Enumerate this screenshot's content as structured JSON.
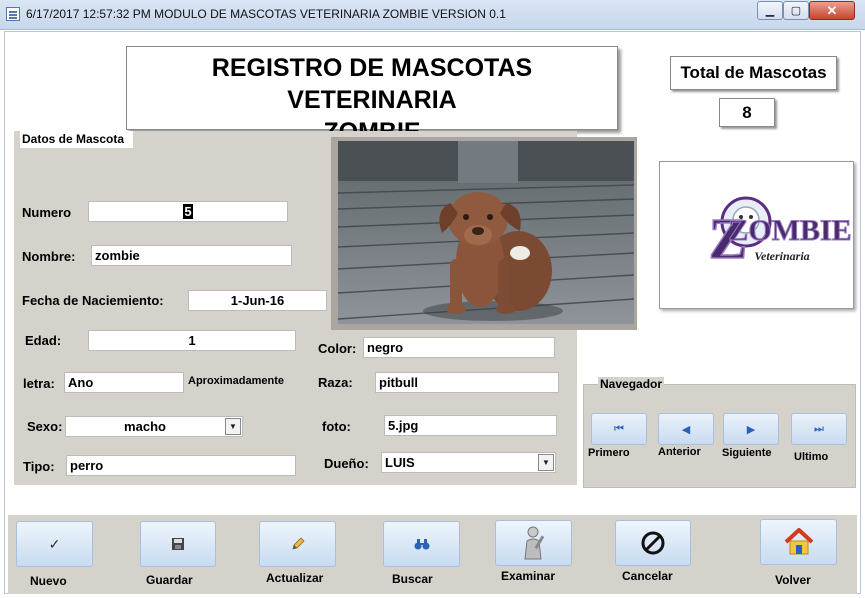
{
  "window": {
    "title": "6/17/2017 12:57:32 PM    MODULO DE MASCOTAS VETERINARIA ZOMBIE VERSION 0.1",
    "minimize": "▁",
    "maximize": "▢",
    "close": "✕"
  },
  "header": {
    "title_line1": "REGISTRO DE MASCOTAS VETERINARIA",
    "title_line2": "ZOMBIE",
    "total_label": "Total de Mascotas",
    "total_value": "8"
  },
  "form": {
    "legend": "Datos de Mascota",
    "numero_label": "Numero",
    "numero_value": "5",
    "nombre_label": "Nombre:",
    "nombre_value": "zombie",
    "fecha_label": "Fecha de Naciemiento:",
    "fecha_value": "1-Jun-16",
    "edad_label": "Edad:",
    "edad_value": "1",
    "letra_label": "letra:",
    "letra_value": "Ano",
    "aprox_label": "Aproximadamente",
    "sexo_label": "Sexo:",
    "sexo_value": "macho",
    "tipo_label": "Tipo:",
    "tipo_value": "perro",
    "color_label": "Color:",
    "color_value": "negro",
    "raza_label": "Raza:",
    "raza_value": "pitbull",
    "foto_label": "foto:",
    "foto_value": "5.jpg",
    "dueno_label": "Dueño:",
    "dueno_value": "LUIS"
  },
  "logo": {
    "word": "ZOMBIE",
    "sub": "Veterinaria"
  },
  "navigator": {
    "legend": "Navegador",
    "first": "Primero",
    "prev": "Anterior",
    "next": "Siguiente",
    "last": "Ultimo"
  },
  "actions": {
    "nuevo": "Nuevo",
    "guardar": "Guardar",
    "actualizar": "Actualizar",
    "buscar": "Buscar",
    "examinar": "Examinar",
    "cancelar": "Cancelar",
    "volver": "Volver"
  },
  "colors": {
    "panel": "#d5d1cb",
    "button_accent": "#2a62b5",
    "logo_purple": "#5a2d82"
  }
}
